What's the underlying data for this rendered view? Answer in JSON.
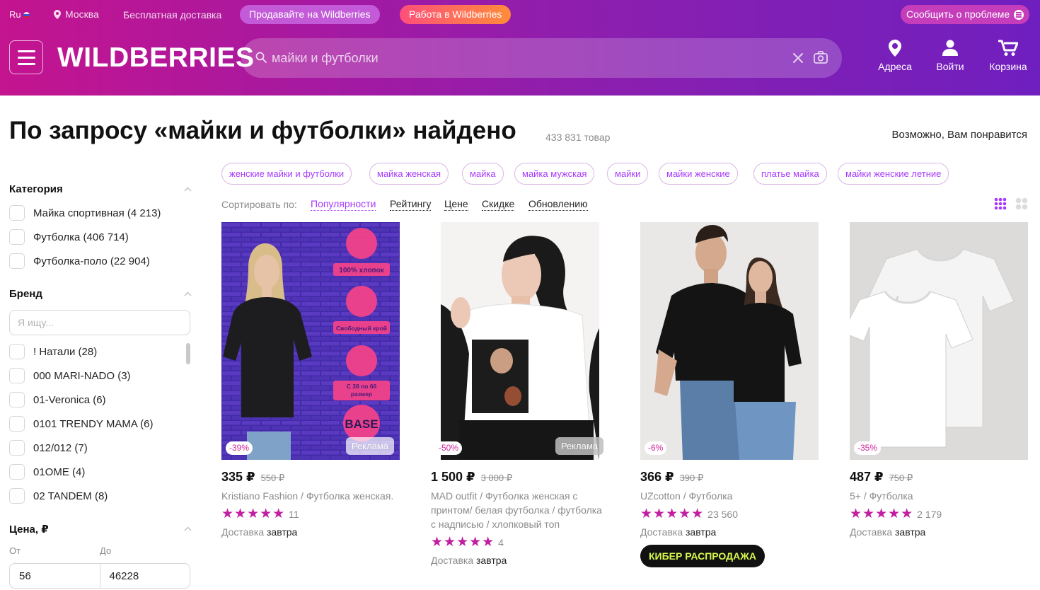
{
  "topbar": {
    "lang": "Ru",
    "city": "Москва",
    "free_delivery": "Бесплатная доставка",
    "sell_label": "Продавайте на Wildberries",
    "work_label": "Работа в Wildberries",
    "report_label": "Сообщить о проблеме"
  },
  "header": {
    "logo": "WILDBERRIES",
    "search_placeholder": "майки и футболки",
    "icons": [
      {
        "label": "Адреса",
        "icon": "location-pin-icon"
      },
      {
        "label": "Войти",
        "icon": "user-icon"
      },
      {
        "label": "Корзина",
        "icon": "cart-icon"
      }
    ]
  },
  "page": {
    "title": "По запросу «майки и футболки» найдено",
    "count": "433 831 товар",
    "recommend": "Возможно, Вам понравится"
  },
  "filters": {
    "category_title": "Категория",
    "categories": [
      "Майка спортивная (4 213)",
      "Футболка (406 714)",
      "Футболка-поло (22 904)"
    ],
    "brand_title": "Бренд",
    "brand_placeholder": "Я ищу...",
    "brands": [
      "! Натали (28)",
      "000 MARI-NADO (3)",
      "01-Veronica (6)",
      "0101 TRENDY MAMA (6)",
      "012/012 (7)",
      "01OME (4)",
      "02 TANDEM (8)"
    ],
    "price_title": "Цена, ₽",
    "price_from_label": "От",
    "price_to_label": "До",
    "price_from": "56",
    "price_to": "46228"
  },
  "tags": [
    "женские майки и футболки",
    "майка женская",
    "майка",
    "майка мужская",
    "майки",
    "майки женские",
    "платье майка",
    "майки женские летние"
  ],
  "sort": {
    "label": "Сортировать по:",
    "options": [
      "Популярности",
      "Рейтингу",
      "Цене",
      "Скидке",
      "Обновлению"
    ],
    "active": "Популярности"
  },
  "products": [
    {
      "price": "335 ₽",
      "old_price": "550 ₽",
      "discount": "-39%",
      "ad": "Реклама",
      "name": "Kristiano Fashion / Футболка женская.",
      "stars": "★★★★★",
      "reviews": "11",
      "delivery_prefix": "Доставка ",
      "delivery": "завтра",
      "img_text": [
        "100% хлопок",
        "Свободный крой",
        "С 38 по 66",
        "размер",
        "BASE"
      ]
    },
    {
      "price": "1 500 ₽",
      "old_price": "3 000 ₽",
      "discount": "-50%",
      "ad": "Реклама",
      "name": "MAD outfit / Футболка женская с принтом/ белая футболка / футболка с надписью / хлопковый топ",
      "stars": "★★★★★",
      "reviews": "4",
      "delivery_prefix": "Доставка ",
      "delivery": "завтра"
    },
    {
      "price": "366 ₽",
      "old_price": "390 ₽",
      "discount": "-6%",
      "name": "UZcotton / Футболка",
      "stars": "★★★★★",
      "reviews": "23 560",
      "delivery_prefix": "Доставка ",
      "delivery": "завтра",
      "badge": "КИБЕР РАСПРОДАЖА"
    },
    {
      "price": "487 ₽",
      "old_price": "750 ₽",
      "discount": "-35%",
      "name": "5+ / Футболка",
      "stars": "★★★★★",
      "reviews": "2 179",
      "delivery_prefix": "Доставка ",
      "delivery": "завтра"
    }
  ],
  "colors": {
    "accent": "#a73afd",
    "brand_pink": "#c4148f",
    "star": "#c11ea0"
  }
}
